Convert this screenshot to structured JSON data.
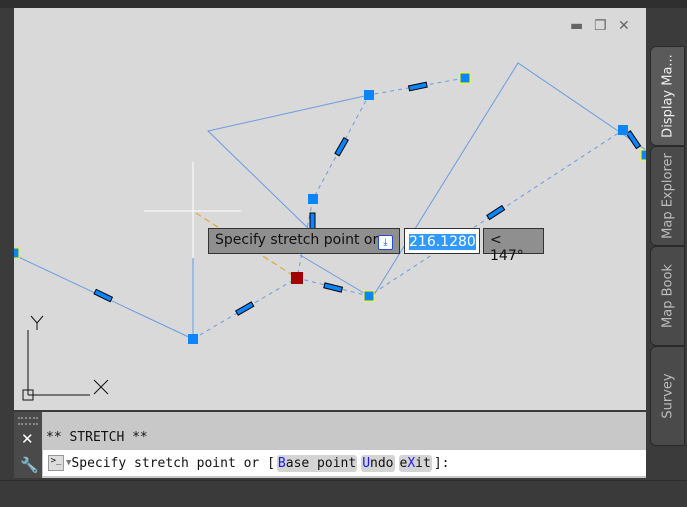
{
  "window_controls": {
    "minimize": "minimize-icon",
    "restore": "restore-icon",
    "close": "close-icon"
  },
  "palette_tabs": [
    "Display Ma...",
    "Map Explorer",
    "Map Book",
    "Survey"
  ],
  "dynamic_input": {
    "prompt": "Specify stretch point or",
    "distance": "216.1280",
    "angle": "< 147°"
  },
  "ucs": {
    "x_label": "X",
    "y_label": "Y"
  },
  "command": {
    "history": "** STRETCH **",
    "prompt_prefix": "Specify stretch point or [",
    "options": [
      {
        "hot": "B",
        "rest": "ase point"
      },
      {
        "hot": "U",
        "rest": "ndo"
      },
      {
        "pre": "e",
        "hot": "X",
        "rest": "it"
      }
    ],
    "prompt_suffix": "]:"
  },
  "colors": {
    "canvas": "#d9d9d9",
    "grip": "#0a84ff",
    "hot_grip": "#a00000",
    "line": "#6a9be0"
  }
}
